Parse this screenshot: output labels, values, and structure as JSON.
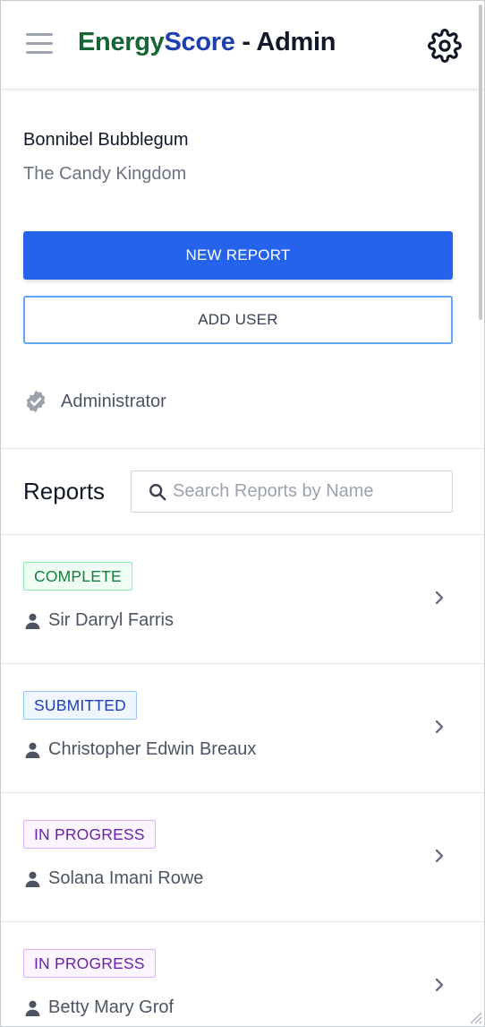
{
  "header": {
    "brand_part1": "Energy",
    "brand_part2": "Score",
    "brand_suffix": " - Admin",
    "menu_icon": "hamburger-menu-icon",
    "settings_icon": "gear-icon"
  },
  "profile": {
    "user_name": "Bonnibel Bubblegum",
    "organization": "The Candy Kingdom",
    "new_report_label": "NEW REPORT",
    "add_user_label": "ADD USER",
    "role_label": "Administrator",
    "role_icon": "verified-badge-icon"
  },
  "reports": {
    "title": "Reports",
    "search_placeholder": "Search Reports by Name",
    "search_value": "",
    "items": [
      {
        "status": "COMPLETE",
        "status_kind": "complete",
        "person": "Sir Darryl Farris"
      },
      {
        "status": "SUBMITTED",
        "status_kind": "submitted",
        "person": "Christopher Edwin Breaux"
      },
      {
        "status": "IN PROGRESS",
        "status_kind": "inprogress",
        "person": "Solana Imani Rowe"
      },
      {
        "status": "IN PROGRESS",
        "status_kind": "inprogress",
        "person": "Betty Mary Grof"
      }
    ]
  },
  "colors": {
    "brand_green": "#166534",
    "brand_blue": "#1e40af",
    "primary_button": "#2563eb",
    "complete": "#15803d",
    "submitted": "#1e40af",
    "in_progress": "#6b21a8"
  }
}
